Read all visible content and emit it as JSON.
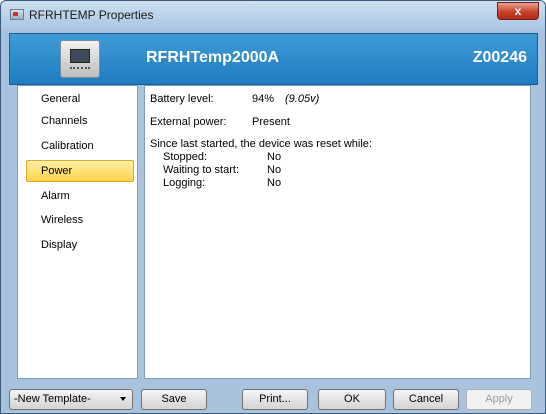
{
  "window": {
    "title": "RFRHTEMP Properties",
    "close_label": "x"
  },
  "header": {
    "device_name": "RFRHTemp2000A",
    "serial": "Z00246"
  },
  "nav": {
    "items": [
      {
        "label": "General"
      },
      {
        "label": "Channels"
      },
      {
        "label": "Calibration"
      },
      {
        "label": "Power",
        "selected": true
      },
      {
        "label": "Alarm"
      },
      {
        "label": "Wireless"
      },
      {
        "label": "Display"
      }
    ]
  },
  "power": {
    "battery_label": "Battery level:",
    "battery_percent": "94%",
    "battery_voltage": "(9.05v)",
    "external_label": "External power:",
    "external_value": "Present",
    "reset_heading": "Since last started, the device was reset while:",
    "resets": [
      {
        "label": "Stopped:",
        "value": "No"
      },
      {
        "label": "Waiting to start:",
        "value": "No"
      },
      {
        "label": "Logging:",
        "value": "No"
      }
    ]
  },
  "footer": {
    "template_select": "-New Template-",
    "save": "Save",
    "print": "Print...",
    "ok": "OK",
    "cancel": "Cancel",
    "apply": "Apply"
  }
}
